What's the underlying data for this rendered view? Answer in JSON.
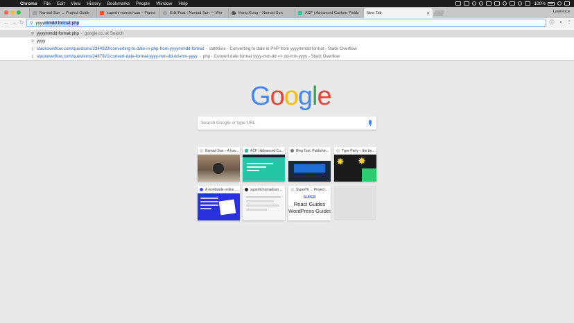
{
  "menubar": {
    "app": "Chrome",
    "items": [
      "File",
      "Edit",
      "View",
      "History",
      "Bookmarks",
      "People",
      "Window",
      "Help"
    ],
    "battery": "100%",
    "user": "Lawrence"
  },
  "tabs": [
    {
      "label": "Nomad Sun → Project Guide",
      "favicon_color": "#9aa0a6"
    },
    {
      "label": "superhi-nomad-sun – Figma",
      "favicon_color": "#f24e1e"
    },
    {
      "label": "Edit Post ‹ Nomad Sun — Wor",
      "favicon_color": "#9aa0a6"
    },
    {
      "label": "Hong Kong – Nomad Sun",
      "favicon_color": "#555555"
    },
    {
      "label": "ACF | Advanced Custom Fields",
      "favicon_color": "#28c79a"
    },
    {
      "label": "New Tab",
      "favicon_color": "#ffffff"
    }
  ],
  "omnibox": {
    "typed": "yyyy",
    "autocomplete": "mmdd format php"
  },
  "suggestions": [
    {
      "icon": "search-icon",
      "main": "yyyymmdd format php",
      "sep": "-",
      "desc": "google.co.uk Search"
    },
    {
      "icon": "search-icon",
      "main": "yyyy",
      "sep": "",
      "desc": ""
    },
    {
      "icon": "page-icon",
      "url": "stackoverflow.com/questions/2344933/converting-to-date-in-php-from-yyyymmdd-format",
      "sep": "-",
      "desc": "datetime - Converting to date in PHP from yyyymmdd format - Stack Overflow"
    },
    {
      "icon": "page-icon",
      "url": "stackoverflow.com/questions/2487921/convert-date-format-yyyy-mm-dd-dd-mm-yyyy",
      "sep": "-",
      "desc": "php - Convert date format yyyy-mm-dd => dd-mm-yyyy - Stack Overflow"
    }
  ],
  "ntp": {
    "logo": [
      "G",
      "o",
      "o",
      "g",
      "l",
      "e"
    ],
    "logo_colors": [
      "#4285f4",
      "#ea4335",
      "#fbbc05",
      "#4285f4",
      "#34a853",
      "#ea4335"
    ],
    "search_placeholder": "Search Google or type URL",
    "tiles": [
      {
        "title": "Nomad Sun – A trav...",
        "favicon_color": "#dddddd"
      },
      {
        "title": "ACF | Advanced Cu...",
        "favicon_color": "#28c79a"
      },
      {
        "title": "Blog Tool, Publishin...",
        "favicon_color": "#777777"
      },
      {
        "title": "Type Party – the be...",
        "favicon_color": "#dddddd"
      },
      {
        "title": "A worldwide online ...",
        "favicon_color": "#3b4cff"
      },
      {
        "title": "superhi/nomadsun ...",
        "favicon_color": "#222222"
      },
      {
        "title": "SuperHi → Project ...",
        "favicon_color": "#dddddd",
        "thumb_brand": "SUPER",
        "thumb_line1": "React Guides",
        "thumb_line2": "WordPress Guides"
      }
    ]
  }
}
